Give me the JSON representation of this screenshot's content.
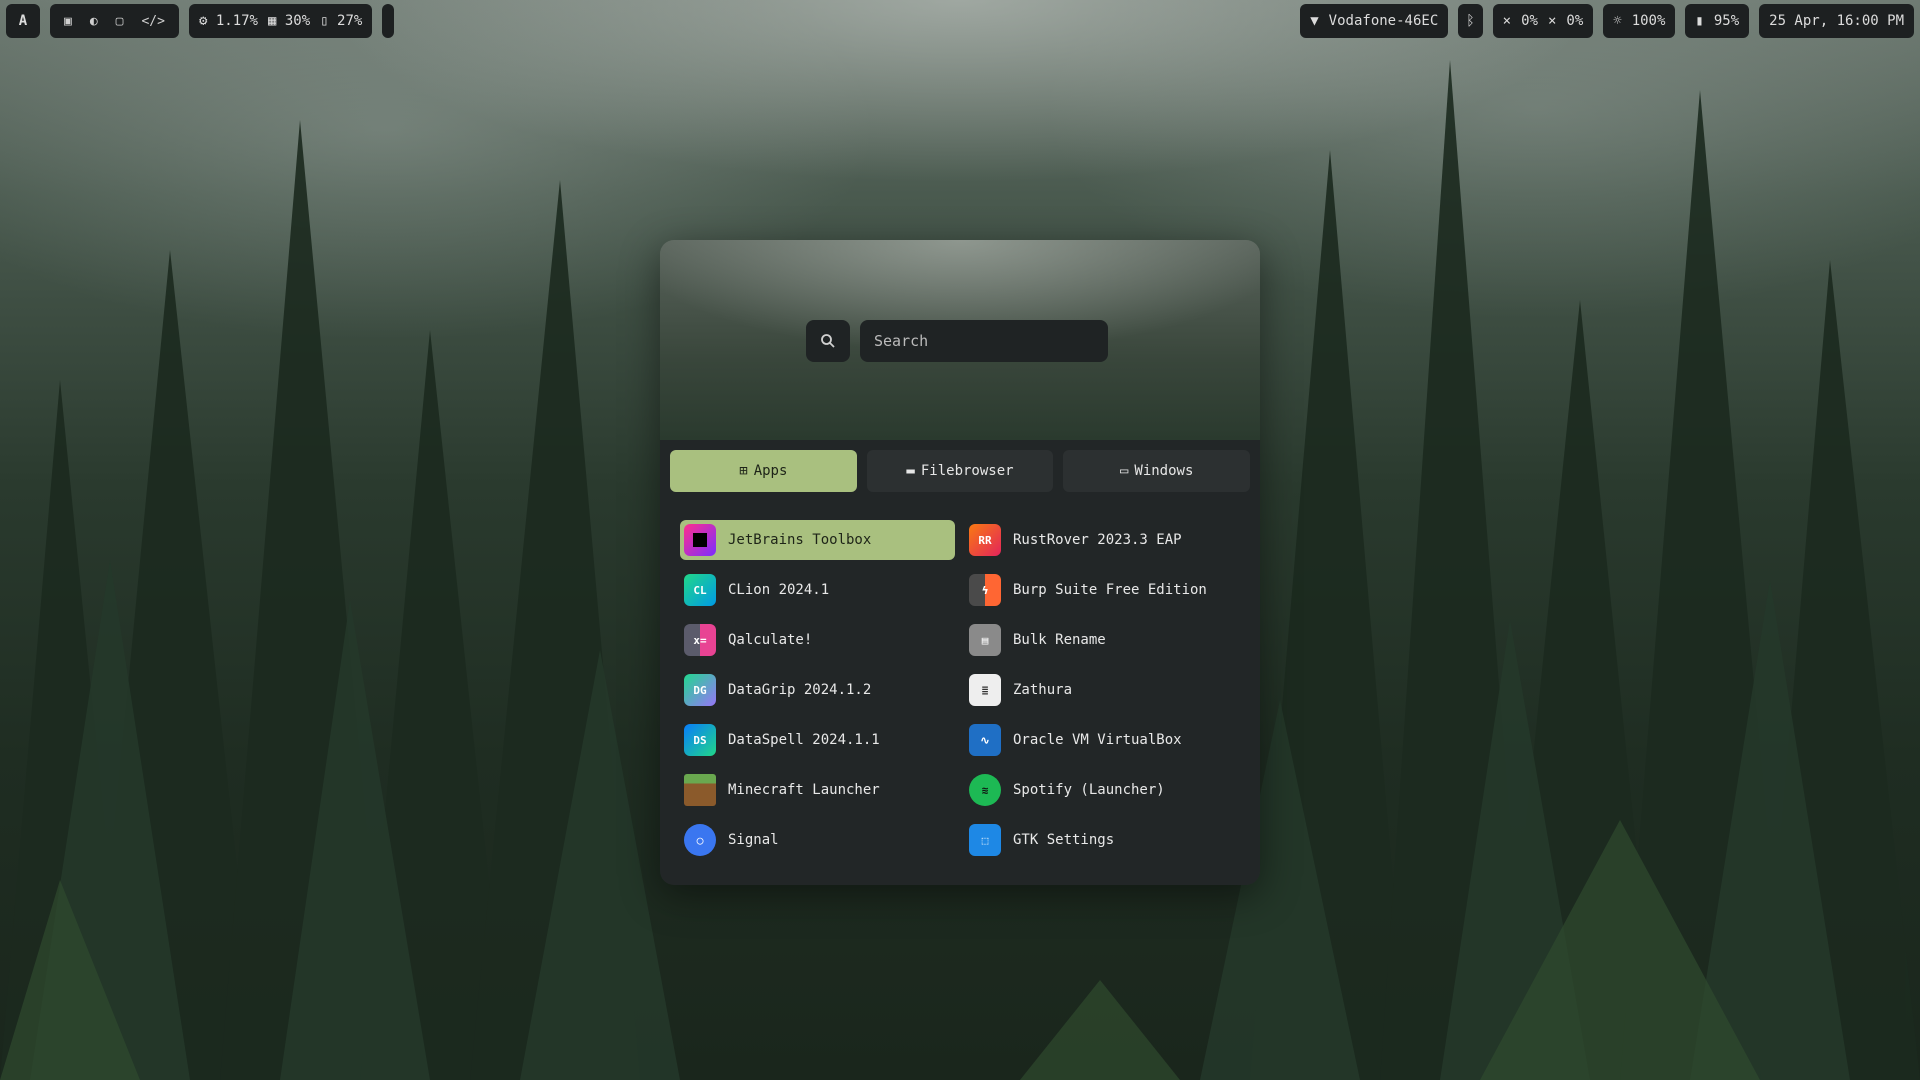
{
  "topbar": {
    "logo": "A",
    "workspace_icons": [
      "terminal-icon",
      "browser-icon",
      "files-icon",
      "code-icon"
    ],
    "stats": {
      "cpu": "1.17%",
      "memory": "30%",
      "disk": "27%"
    },
    "right": {
      "wifi": "Vodafone-46EC",
      "volume": "0%",
      "mic": "0%",
      "brightness": "100%",
      "battery": "95%",
      "datetime": "25 Apr, 16:00 PM"
    }
  },
  "launcher": {
    "search": {
      "placeholder": "Search",
      "value": ""
    },
    "tabs": [
      {
        "label": "Apps",
        "icon": "grid-icon",
        "active": true
      },
      {
        "label": "Filebrowser",
        "icon": "folder-icon",
        "active": false
      },
      {
        "label": "Windows",
        "icon": "window-icon",
        "active": false
      }
    ],
    "apps": [
      {
        "name": "JetBrains Toolbox",
        "icon": "jetbrains-toolbox-icon",
        "selected": true
      },
      {
        "name": "RustRover 2023.3 EAP",
        "icon": "rustrover-icon",
        "selected": false
      },
      {
        "name": "CLion 2024.1",
        "icon": "clion-icon",
        "selected": false
      },
      {
        "name": "Burp Suite Free Edition",
        "icon": "burp-suite-icon",
        "selected": false
      },
      {
        "name": "Qalculate!",
        "icon": "qalculate-icon",
        "selected": false
      },
      {
        "name": "Bulk Rename",
        "icon": "bulk-rename-icon",
        "selected": false
      },
      {
        "name": "DataGrip 2024.1.2",
        "icon": "datagrip-icon",
        "selected": false
      },
      {
        "name": "Zathura",
        "icon": "zathura-icon",
        "selected": false
      },
      {
        "name": "DataSpell 2024.1.1",
        "icon": "dataspell-icon",
        "selected": false
      },
      {
        "name": "Oracle VM VirtualBox",
        "icon": "virtualbox-icon",
        "selected": false
      },
      {
        "name": "Minecraft Launcher",
        "icon": "minecraft-icon",
        "selected": false
      },
      {
        "name": "Spotify (Launcher)",
        "icon": "spotify-icon",
        "selected": false
      },
      {
        "name": "Signal",
        "icon": "signal-icon",
        "selected": false
      },
      {
        "name": "GTK Settings",
        "icon": "gtk-settings-icon",
        "selected": false
      }
    ],
    "icon_labels": {
      "clion": "CL",
      "datagrip": "DG",
      "dataspell": "DS",
      "rustrover": "RR"
    }
  },
  "colors": {
    "accent": "#a9c07f",
    "panel": "#222627",
    "bar": "#1d2021"
  }
}
